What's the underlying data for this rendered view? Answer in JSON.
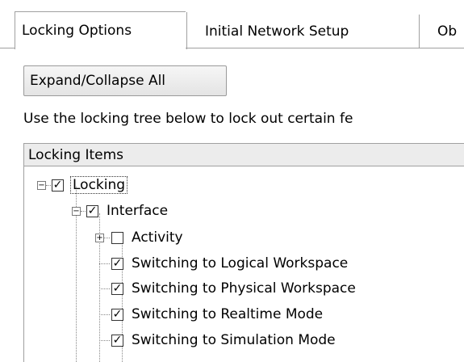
{
  "tabs": [
    {
      "label": "Locking Options"
    },
    {
      "label": "Initial Network Setup"
    },
    {
      "label": "Ob"
    }
  ],
  "toolbar": {
    "expand_collapse_label": "Expand/Collapse All"
  },
  "hint": "Use the locking tree below to lock out certain fe",
  "tree": {
    "header": "Locking Items",
    "items": [
      {
        "label": "Locking",
        "checked": true,
        "expander": "minus"
      },
      {
        "label": "Interface",
        "checked": true,
        "expander": "minus"
      },
      {
        "label": "Activity",
        "checked": false,
        "expander": "plus"
      },
      {
        "label": "Switching to Logical Workspace",
        "checked": true
      },
      {
        "label": "Switching to Physical Workspace",
        "checked": true
      },
      {
        "label": "Switching to Realtime Mode",
        "checked": true
      },
      {
        "label": "Switching to Simulation Mode",
        "checked": true
      }
    ]
  }
}
